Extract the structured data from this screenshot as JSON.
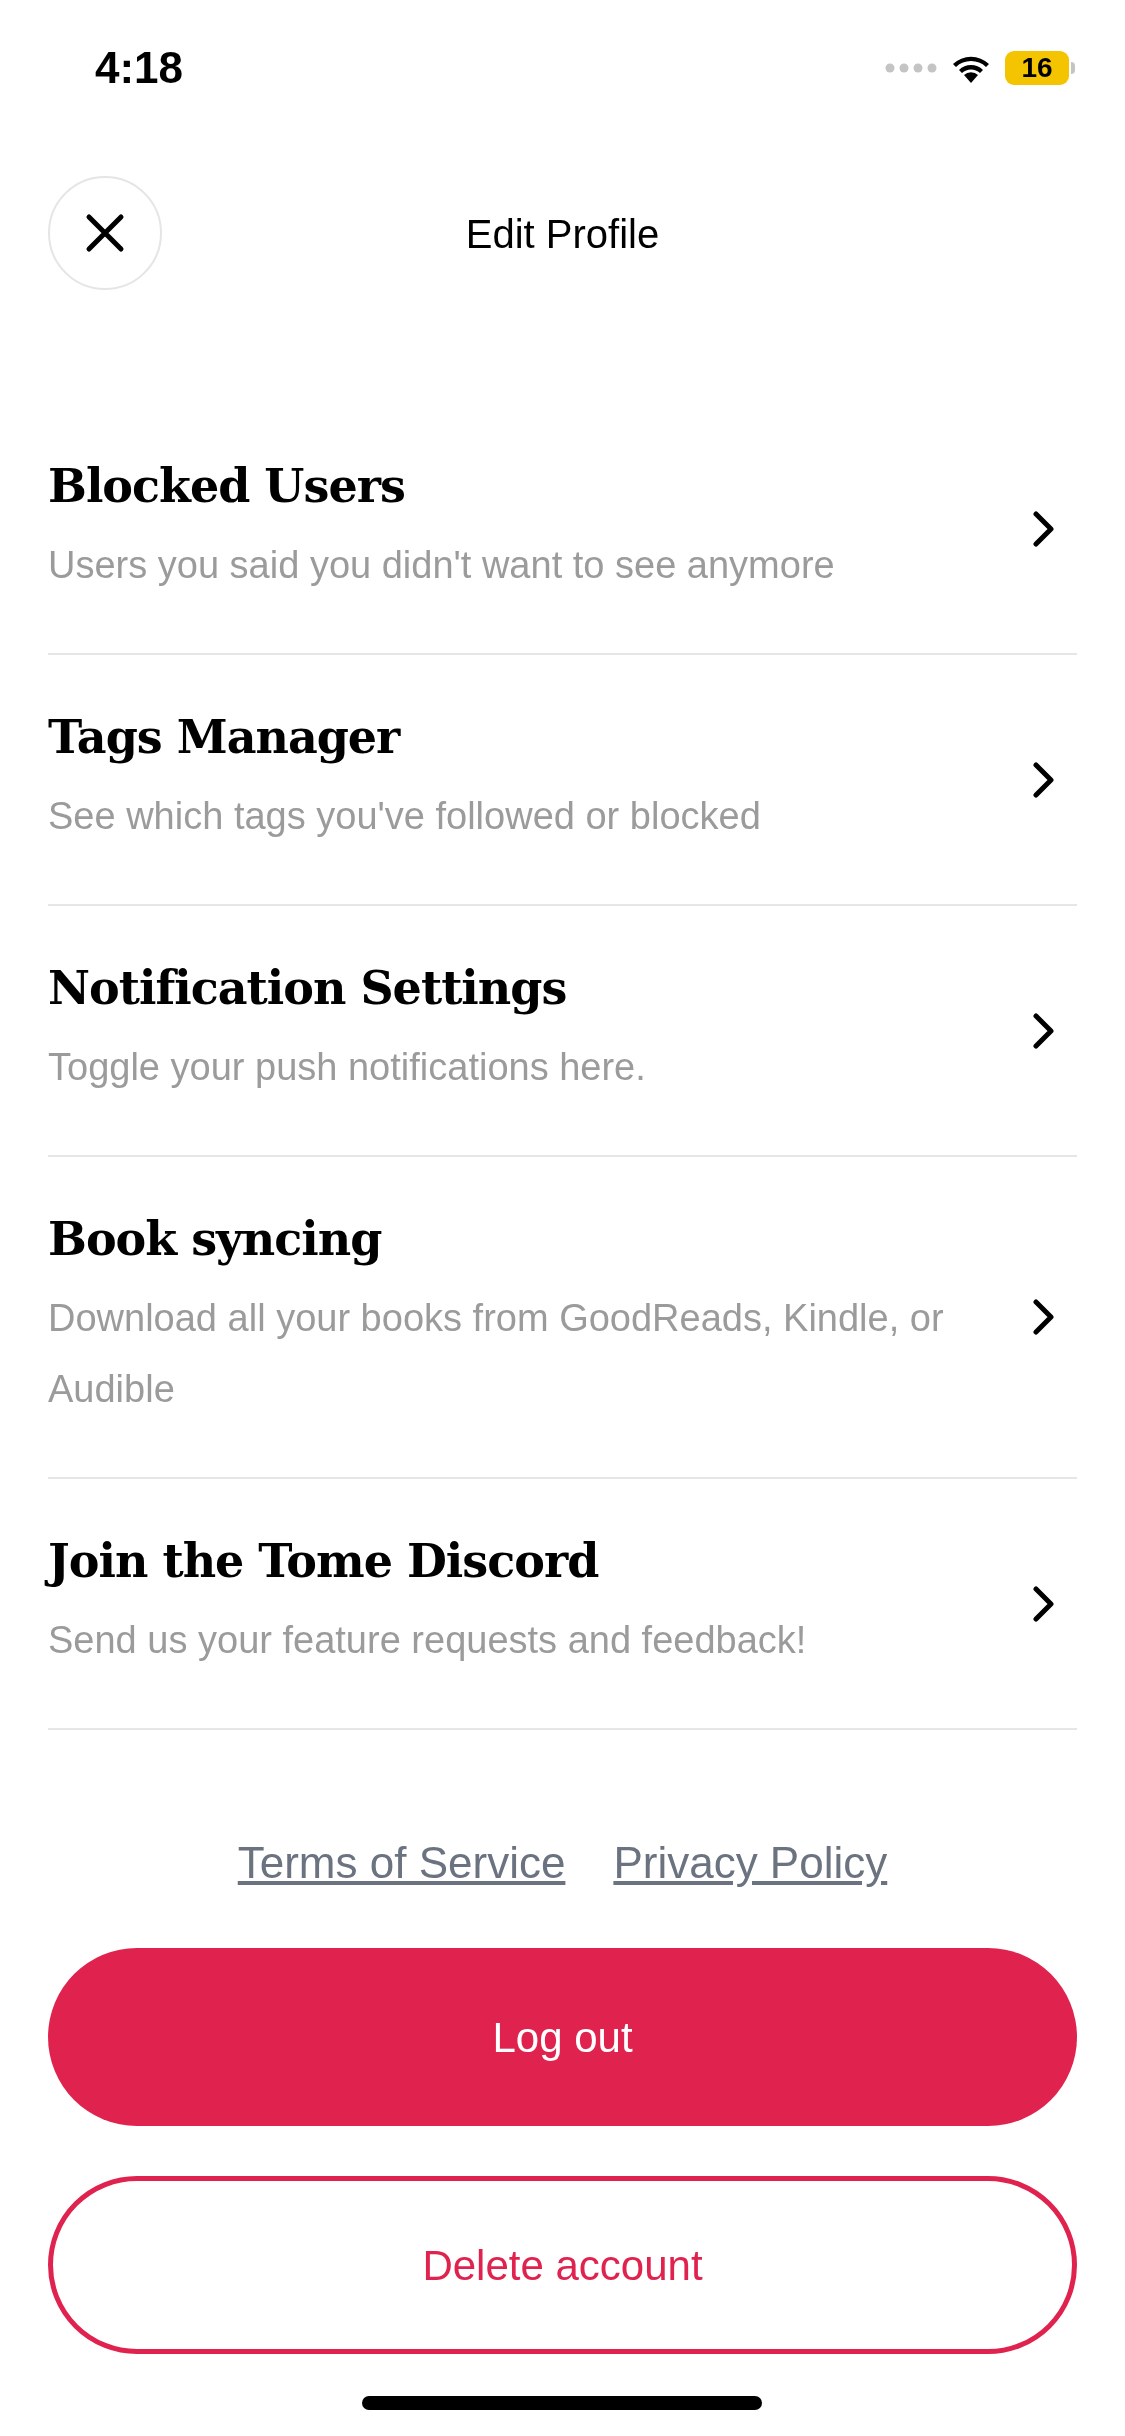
{
  "status_bar": {
    "time": "4:18",
    "battery": "16"
  },
  "header": {
    "title": "Edit Profile"
  },
  "items": [
    {
      "title": "Blocked Users",
      "subtitle": "Users you said you didn't want to see anymore"
    },
    {
      "title": "Tags Manager",
      "subtitle": "See which tags you've followed or blocked"
    },
    {
      "title": "Notification Settings",
      "subtitle": "Toggle your push notifications here."
    },
    {
      "title": "Book syncing",
      "subtitle": "Download all your books from GoodReads, Kindle, or Audible"
    },
    {
      "title": "Join the Tome Discord",
      "subtitle": "Send us your feature requests and feedback!"
    }
  ],
  "links": [
    "Terms of Service",
    "Privacy Policy"
  ],
  "buttons": [
    {
      "label": "Log out",
      "kind": "filled"
    },
    {
      "label": "Delete account",
      "kind": "outline"
    }
  ]
}
